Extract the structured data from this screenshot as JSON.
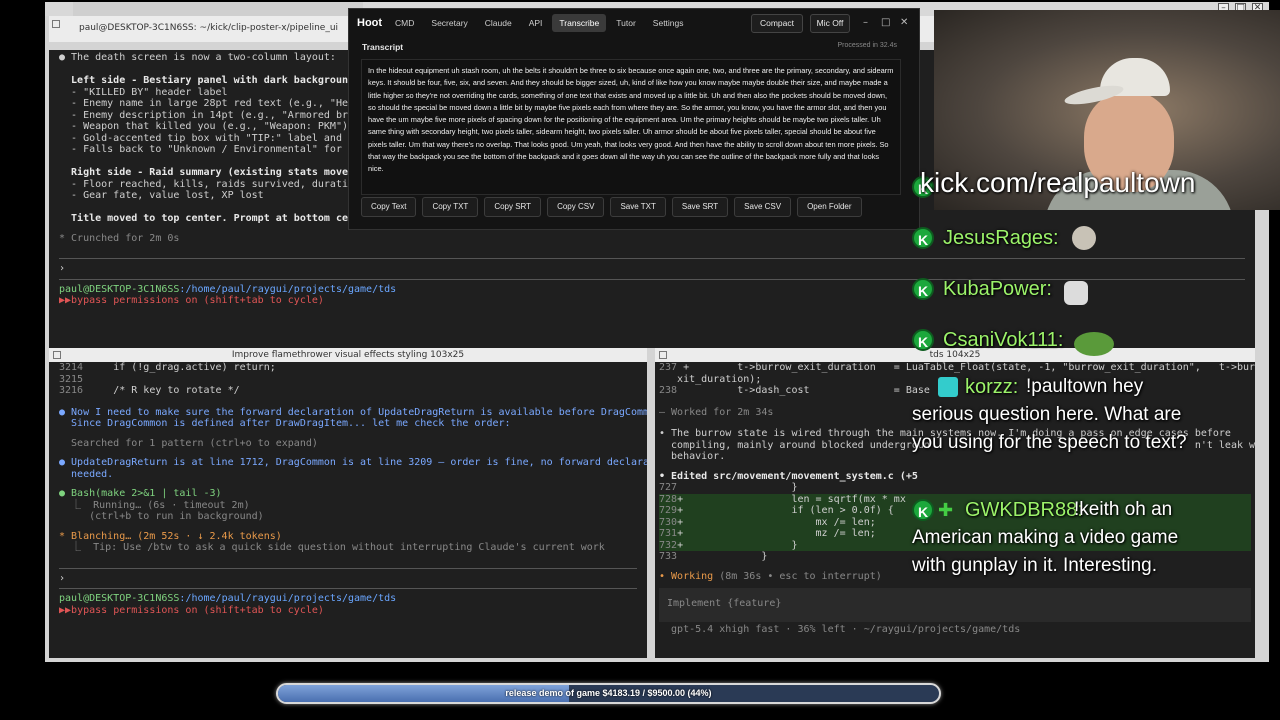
{
  "os_window": {
    "title": "paul@DESKTOP-3C1N6SS: ~/kick/clip-poster-x/pipeline_ui",
    "ctrl_min": "–",
    "ctrl_max": "□",
    "ctrl_close": "✕"
  },
  "pane_top": {
    "lines": [
      "● The death screen is now a two-column layout:",
      "",
      "  Left side - Bestiary panel with dark background bo",
      "  - \"KILLED BY\" header label",
      "  - Enemy name in large 28pt red text (e.g., \"Heavy\"",
      "  - Enemy description in 14pt (e.g., \"Armored brute.",
      "  - Weapon that killed you (e.g., \"Weapon: PKM\")",
      "  - Gold-accented tip box with \"TIP:\" label and a ra",
      "  - Falls back to \"Unknown / Environmental\" for time",
      "",
      "  Right side - Raid summary (existing stats moved to",
      "  - Floor reached, kills, raids survived, duration",
      "  - Gear fate, value lost, XP lost",
      "",
      "  Title moved to top center. Prompt at bottom center"
    ],
    "crunched": "* Crunched for 2m 0s",
    "prompt_caret": "›",
    "user": "paul@DESKTOP-3C1N6SS",
    "path": ":/home/paul/raygui/projects/game/tds",
    "bypass": "bypass permissions on (shift+tab to cycle)"
  },
  "pane_left": {
    "tab_title": "Improve flamethrower visual effects styling 103x25",
    "code": [
      {
        "num": "3214",
        "text": "    if (!g_drag.active) return;"
      },
      {
        "num": "3215",
        "text": ""
      },
      {
        "num": "3216",
        "text": "    /* R key to rotate */"
      }
    ],
    "msg1": "● Now I need to make sure the forward declaration of UpdateDragReturn is available before DragCommon.",
    "msg1b": "  Since DragCommon is defined after DrawDragItem... let me check the order:",
    "search": "  Searched for 1 pattern (ctrl+o to expand)",
    "msg2": "● UpdateDragReturn is at line 1712, DragCommon is at line 3209 — order is fine, no forward declaration",
    "msg2b": "  needed.",
    "bash": "● Bash(make 2>&1 | tail -3)",
    "running": "  ⎿  Running… (6s · timeout 2m)",
    "background": "     (ctrl+b to run in background)",
    "blanching": "* Blanching… (2m 52s · ↓ 2.4k tokens)",
    "tip": "  ⎿  Tip: Use /btw to ask a quick side question without interrupting Claude's current work",
    "prompt_caret": "›",
    "user": "paul@DESKTOP-3C1N6SS",
    "path": ":/home/paul/raygui/projects/game/tds",
    "bypass": "bypass permissions on (shift+tab to cycle)"
  },
  "pane_right": {
    "tab_title": "tds 104x25",
    "code": [
      {
        "num": "237",
        "text": " +        t->burrow_exit_duration   = LuaTable_Float(state, -1, \"burrow_exit_duration\",   t->burrow_e"
      },
      {
        "num": "",
        "text": "   xit_duration);"
      },
      {
        "num": "238",
        "text": "          t->dash_cost              = Base"
      }
    ],
    "worked": "— Worked for 2m 34s",
    "msg": "• The burrow state is wired through the main systems now. I'm doing a pass on edge cases before",
    "msg2": "  compiling, mainly around blocked undergroun                                            n't leak weird",
    "msg3": "  behavior.",
    "edited": "• Edited src/movement/movement_system.c (+5",
    "diff": [
      {
        "num": "727",
        "text": "                   }",
        "add": false
      },
      {
        "num": "728",
        "text": "+                  len = sqrtf(mx * mx",
        "add": true
      },
      {
        "num": "729",
        "text": "+                  if (len > 0.0f) {",
        "add": true
      },
      {
        "num": "730",
        "text": "+                      mx /= len;",
        "add": true
      },
      {
        "num": "731",
        "text": "+                      mz /= len;",
        "add": true
      },
      {
        "num": "732",
        "text": "+                  }",
        "add": true
      },
      {
        "num": "733",
        "text": "              }",
        "add": false
      }
    ],
    "working": "• Working",
    "working_meta": " (8m 36s • esc to interrupt)",
    "input_placeholder": "Implement {feature}",
    "status": "  gpt-5.4 xhigh fast · 36% left · ~/raygui/projects/game/tds"
  },
  "hoot": {
    "brand": "Hoot",
    "tabs": [
      "CMD",
      "Secretary",
      "Claude",
      "API",
      "Transcribe",
      "Tutor",
      "Settings"
    ],
    "active_tab": "Transcribe",
    "compact": "Compact",
    "mic": "Mic Off",
    "heading": "Transcript",
    "processed": "Processed in 32.4s",
    "transcript": "In the hideout equipment uh stash room, uh the belts it shouldn't be three to six because once again one, two, and three are the primary, secondary, and sidearm keys. It should be four, five, six, and seven. And they should be bigger sized, uh, kind of like how you know maybe maybe double their size, and maybe made a little higher so they're not overriding the cards, something of one text that exists and moved up a little bit. Uh and then also the pockets should be moved down, so should the special be moved down a little bit by maybe five pixels each from where they are. So the armor, you know, you have the armor slot, and then you have the um maybe five more pixels of spacing down for the positioning of the equipment area. Um the primary heights should be maybe two pixels taller. Uh same thing with secondary height, two pixels taller, sidearm height, two pixels taller. Uh armor should be about five pixels taller, special should be about five pixels taller. Um that way there's no overlap. That looks good. Um yeah, that looks very good. And then have the ability to scroll down about ten more pixels. So that way the backpack you see the bottom of the backpack and it goes down all the way uh you can see the outline of the backpack more fully and that looks nice.",
    "actions": [
      "Copy Text",
      "Copy TXT",
      "Copy SRT",
      "Copy CSV",
      "Save TXT",
      "Save SRT",
      "Save CSV",
      "Open Folder"
    ],
    "win_min": "–",
    "win_max": "□",
    "win_close": "✕"
  },
  "chat": {
    "url": "kick.com/realpaultown",
    "badge": "K",
    "messages": [
      {
        "name": "JesusRages:",
        "text": ""
      },
      {
        "name": "KubaPower:",
        "text": ""
      },
      {
        "name": "CsaniVok111:",
        "text": ""
      },
      {
        "name": "korzz:",
        "text": "!paultown hey serious question here. What are you using for the speech to text?"
      },
      {
        "name": "GWKDBR88:",
        "text": "!keith oh an American making a video game with gunplay in it. Interesting."
      }
    ]
  },
  "goal": {
    "label": "release demo of game $4183.19 / $9500.00 (44%)",
    "progress": 0.44
  }
}
